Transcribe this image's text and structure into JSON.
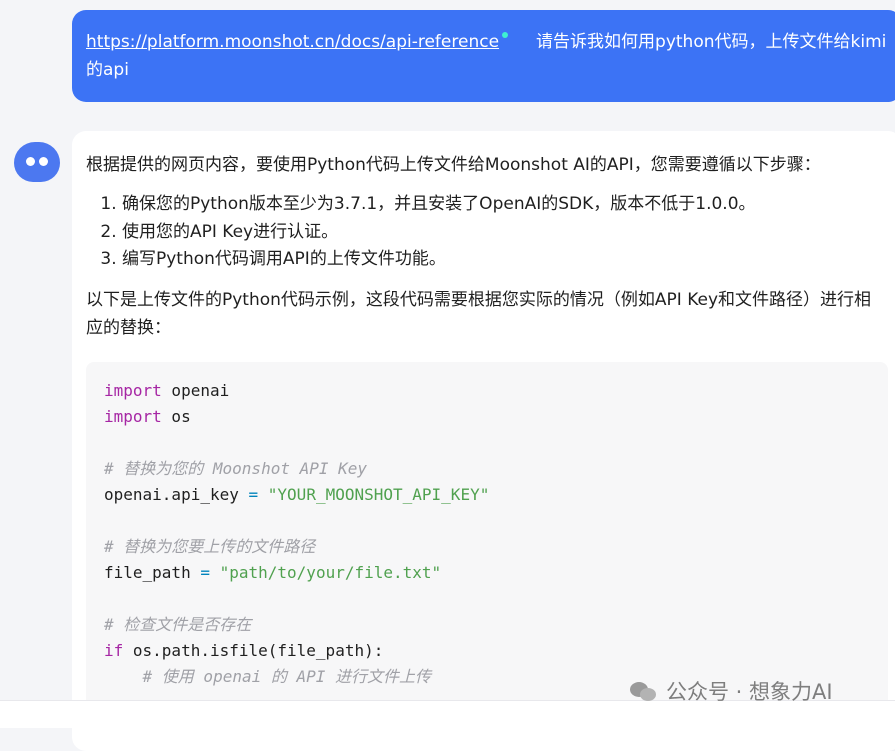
{
  "user_message": {
    "link": "https://platform.moonshot.cn/docs/api-reference",
    "text": "请告诉我如何用python代码，上传文件给kimi 的api"
  },
  "assistant": {
    "intro": "根据提供的网页内容，要使用Python代码上传文件给Moonshot AI的API，您需要遵循以下步骤：",
    "steps": [
      "确保您的Python版本至少为3.7.1，并且安装了OpenAI的SDK，版本不低于1.0.0。",
      "使用您的API Key进行认证。",
      "编写Python代码调用API的上传文件功能。"
    ],
    "code_intro": "以下是上传文件的Python代码示例，这段代码需要根据您实际的情况（例如API Key和文件路径）进行相应的替换：",
    "code": {
      "l1_kw": "import",
      "l1_rest": " openai",
      "l2_kw": "import",
      "l2_rest": " os",
      "c1": "# 替换为您的 Moonshot API Key",
      "l3_a": "openai.api_key ",
      "l3_op": "=",
      "l3_str": "\"YOUR_MOONSHOT_API_KEY\"",
      "c2": "# 替换为您要上传的文件路径",
      "l4_a": "file_path ",
      "l4_op": "=",
      "l4_str": "\"path/to/your/file.txt\"",
      "c3": "# 检查文件是否存在",
      "l5_kw": "if",
      "l5_rest": " os.path.isfile(file_path):",
      "c4": "    # 使用 openai 的 API 进行文件上传"
    }
  },
  "watermark": "公众号 · 想象力AI",
  "colors": {
    "user_bubble": "#3c73f5",
    "avatar": "#4c78f0",
    "keyword": "#a626a4",
    "string": "#50a14f",
    "comment": "#a0a1a7"
  },
  "icons": [
    "bot-avatar-icon",
    "wechat-icon"
  ]
}
